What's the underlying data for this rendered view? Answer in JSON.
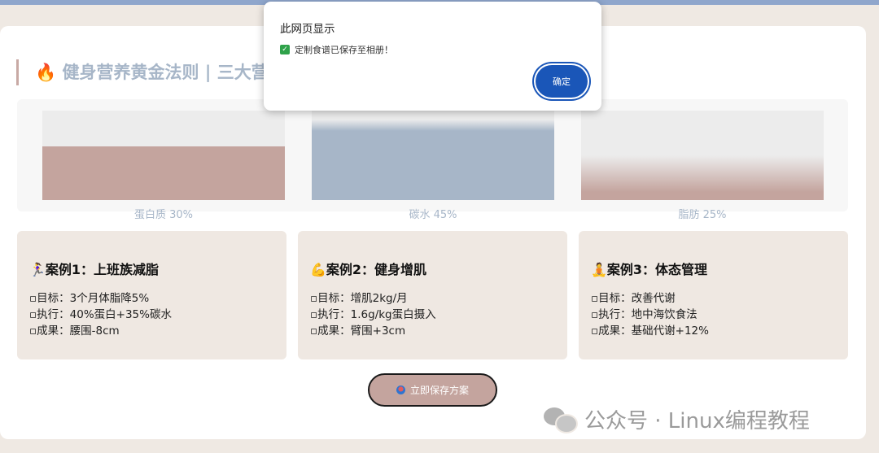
{
  "page": {
    "title": "🔥 健身营养黄金法则 | 三大营",
    "accent_color": "#c4a49e",
    "secondary_color": "#a7b6c8"
  },
  "chart_data": {
    "type": "bar",
    "categories": [
      "蛋白质 30%",
      "碳水 45%",
      "脂肪 25%"
    ],
    "values": [
      30,
      45,
      25
    ],
    "ylim": [
      0,
      50
    ],
    "grid": false,
    "title": "",
    "xlabel": "",
    "ylabel": ""
  },
  "cases": [
    {
      "title": "🏃‍♀️案例1：上班族减脂",
      "lines": [
        "▫目标：3个月体脂降5%",
        "▫执行：40%蛋白+35%碳水",
        "▫成果：腰围-8cm"
      ]
    },
    {
      "title": "💪案例2：健身增肌",
      "lines": [
        "▫目标：增肌2kg/月",
        "▫执行：1.6g/kg蛋白摄入",
        "▫成果：臂围+3cm"
      ]
    },
    {
      "title": "🧘案例3：体态管理",
      "lines": [
        "▫目标：改善代谢",
        "▫执行：地中海饮食法",
        "▫成果：基础代谢+12%"
      ]
    }
  ],
  "save_button": {
    "label": "立即保存方案",
    "icon": "save-icon"
  },
  "watermark": {
    "text": "公众号 · Linux编程教程",
    "icon": "wechat-icon"
  },
  "dialog": {
    "title": "此网页显示",
    "message": "定制食谱已保存至相册！",
    "ok_label": "确定",
    "icon": "checkmark-icon"
  }
}
